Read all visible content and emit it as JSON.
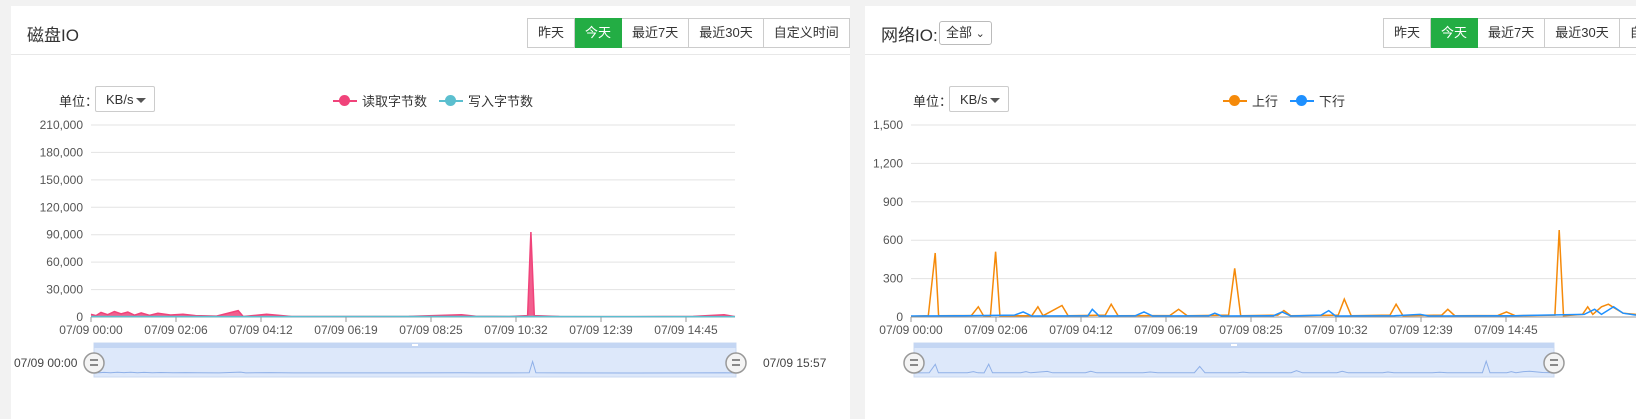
{
  "disk": {
    "title": "磁盘IO",
    "buttons": [
      {
        "label": "昨天",
        "active": false
      },
      {
        "label": "今天",
        "active": true
      },
      {
        "label": "最近7天",
        "active": false
      },
      {
        "label": "最近30天",
        "active": false
      },
      {
        "label": "自定义时间",
        "active": false
      }
    ],
    "unit_label": "单位：",
    "unit_value": "KB/s",
    "range_start": "07/09 00:00",
    "range_end": "07/09 15:57"
  },
  "network": {
    "title": "网络IO:",
    "scope_value": "全部",
    "buttons": [
      {
        "label": "昨天",
        "active": false
      },
      {
        "label": "今天",
        "active": true
      },
      {
        "label": "最近7天",
        "active": false
      },
      {
        "label": "最近30天",
        "active": false
      },
      {
        "label": "自定义时间",
        "active": false
      }
    ],
    "unit_label": "单位：",
    "unit_value": "KB/s"
  },
  "colors": {
    "accent": "#23ad44",
    "read": "#f0437a",
    "write": "#5bbfcf",
    "up": "#f58a0a",
    "down": "#1e90ff"
  },
  "chart_data": [
    {
      "type": "area",
      "x_ticks": [
        "07/09 00:00",
        "07/09 02:06",
        "07/09 04:12",
        "07/09 06:19",
        "07/09 08:25",
        "07/09 10:32",
        "07/09 12:39",
        "07/09 14:45"
      ],
      "y_ticks": [
        "0",
        "30,000",
        "60,000",
        "90,000",
        "120,000",
        "150,000",
        "180,000",
        "210,000"
      ],
      "ylim": [
        0,
        210000
      ],
      "series": [
        {
          "name": "读取字节数",
          "color": "#f0437a",
          "points": [
            [
              0,
              3000
            ],
            [
              6,
              1500
            ],
            [
              12,
              5000
            ],
            [
              20,
              2500
            ],
            [
              28,
              6000
            ],
            [
              36,
              3500
            ],
            [
              44,
              5500
            ],
            [
              52,
              2000
            ],
            [
              60,
              4500
            ],
            [
              70,
              1800
            ],
            [
              80,
              4000
            ],
            [
              95,
              2200
            ],
            [
              110,
              3000
            ],
            [
              125,
              1500
            ],
            [
              150,
              1000
            ],
            [
              176,
              7000
            ],
            [
              182,
              500
            ],
            [
              210,
              3000
            ],
            [
              240,
              600
            ],
            [
              300,
              600
            ],
            [
              380,
              700
            ],
            [
              443,
              2500
            ],
            [
              460,
              800
            ],
            [
              500,
              600
            ],
            [
              522,
              1500
            ],
            [
              526,
              93000
            ],
            [
              530,
              1500
            ],
            [
              560,
              500
            ],
            [
              640,
              400
            ],
            [
              720,
              700
            ],
            [
              757,
              2500
            ],
            [
              770,
              400
            ]
          ]
        },
        {
          "name": "写入字节数",
          "color": "#5bbfcf",
          "points": [
            [
              0,
              500
            ],
            [
              200,
              400
            ],
            [
              400,
              500
            ],
            [
              600,
              400
            ],
            [
              770,
              400
            ]
          ]
        }
      ]
    },
    {
      "type": "line",
      "x_ticks": [
        "07/09 00:00",
        "07/09 02:06",
        "07/09 04:12",
        "07/09 06:19",
        "07/09 08:25",
        "07/09 10:32",
        "07/09 12:39",
        "07/09 14:45"
      ],
      "y_ticks": [
        "0",
        "300",
        "600",
        "900",
        "1,200",
        "1,500"
      ],
      "ylim": [
        0,
        1500
      ],
      "series": [
        {
          "name": "上行",
          "color": "#f58a0a",
          "points": [
            [
              0,
              5
            ],
            [
              20,
              10
            ],
            [
              28,
              500
            ],
            [
              32,
              10
            ],
            [
              70,
              12
            ],
            [
              78,
              80
            ],
            [
              84,
              10
            ],
            [
              92,
              8
            ],
            [
              98,
              510
            ],
            [
              103,
              10
            ],
            [
              140,
              10
            ],
            [
              147,
              80
            ],
            [
              153,
              10
            ],
            [
              175,
              90
            ],
            [
              182,
              10
            ],
            [
              225,
              15
            ],
            [
              232,
              100
            ],
            [
              240,
              10
            ],
            [
              300,
              12
            ],
            [
              310,
              60
            ],
            [
              320,
              10
            ],
            [
              368,
              15
            ],
            [
              375,
              380
            ],
            [
              382,
              10
            ],
            [
              425,
              15
            ],
            [
              432,
              50
            ],
            [
              440,
              10
            ],
            [
              495,
              15
            ],
            [
              502,
              140
            ],
            [
              510,
              10
            ],
            [
              555,
              15
            ],
            [
              562,
              100
            ],
            [
              570,
              10
            ],
            [
              615,
              15
            ],
            [
              622,
              60
            ],
            [
              630,
              10
            ],
            [
              680,
              12
            ],
            [
              690,
              40
            ],
            [
              700,
              10
            ],
            [
              746,
              15
            ],
            [
              751,
              680
            ],
            [
              756,
              10
            ],
            [
              778,
              20
            ],
            [
              784,
              80
            ],
            [
              790,
              20
            ],
            [
              800,
              80
            ],
            [
              808,
              100
            ],
            [
              815,
              70
            ],
            [
              825,
              30
            ],
            [
              840,
              20
            ]
          ]
        },
        {
          "name": "下行",
          "color": "#1e90ff",
          "points": [
            [
              0,
              8
            ],
            [
              60,
              10
            ],
            [
              120,
              15
            ],
            [
              130,
              40
            ],
            [
              140,
              8
            ],
            [
              205,
              10
            ],
            [
              210,
              60
            ],
            [
              218,
              8
            ],
            [
              260,
              10
            ],
            [
              270,
              40
            ],
            [
              280,
              8
            ],
            [
              345,
              10
            ],
            [
              352,
              30
            ],
            [
              360,
              8
            ],
            [
              420,
              10
            ],
            [
              430,
              40
            ],
            [
              440,
              8
            ],
            [
              475,
              15
            ],
            [
              484,
              50
            ],
            [
              492,
              8
            ],
            [
              560,
              10
            ],
            [
              590,
              20
            ],
            [
              600,
              8
            ],
            [
              700,
              10
            ],
            [
              780,
              20
            ],
            [
              792,
              60
            ],
            [
              800,
              20
            ],
            [
              814,
              80
            ],
            [
              825,
              30
            ],
            [
              840,
              15
            ]
          ]
        }
      ]
    }
  ]
}
